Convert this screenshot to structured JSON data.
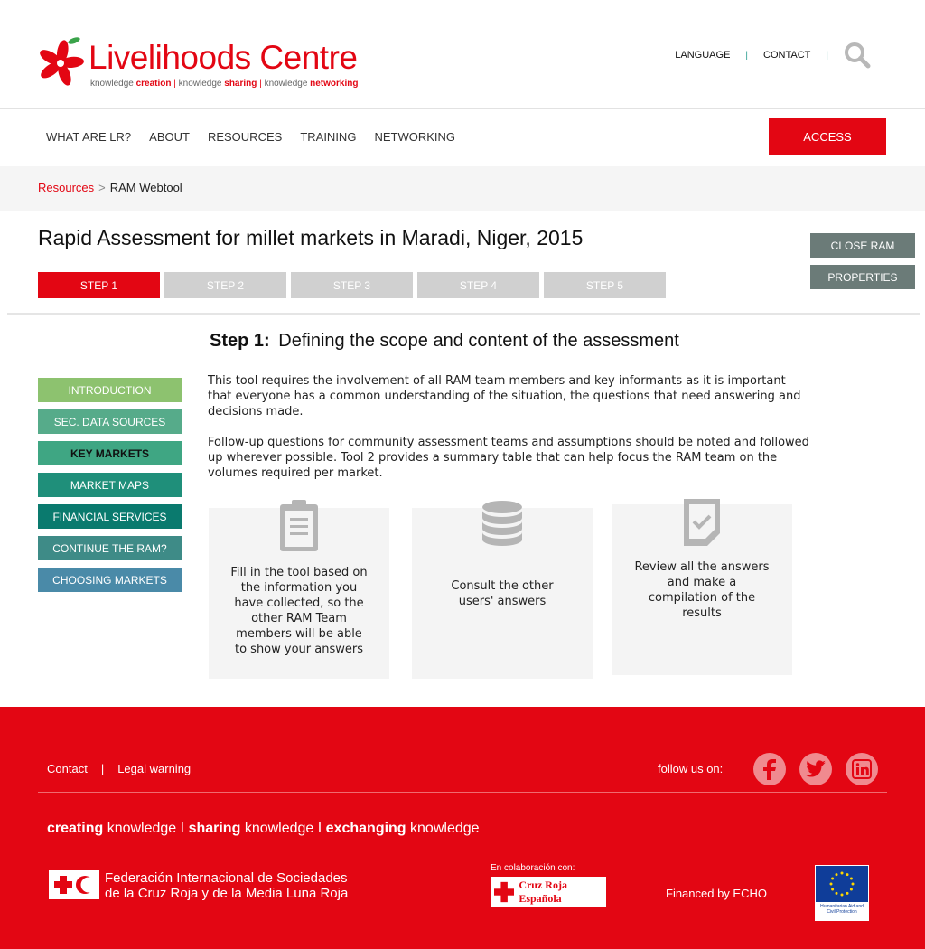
{
  "brand": {
    "title_part1": "Live",
    "title_part2": "lihoods Centre",
    "tagline_prefix1": "knowledge",
    "tagline_word1": "creation",
    "tagline_prefix2": "knowledge",
    "tagline_word2": "sharing",
    "tagline_prefix3": "knowledge",
    "tagline_word3": "networking",
    "tagline_sep": "|",
    "accent_color": "#e30613"
  },
  "top_links": {
    "language": "LANGUAGE",
    "contact": "CONTACT",
    "separator": "|",
    "search_icon": "search-icon"
  },
  "nav": {
    "items": [
      "WHAT ARE LR?",
      "ABOUT",
      "RESOURCES",
      "TRAINING",
      "NETWORKING"
    ],
    "access": "ACCESS"
  },
  "breadcrumb": {
    "link": "Resources",
    "separator": ">",
    "current": "RAM Webtool"
  },
  "page": {
    "title": "Rapid Assessment for millet markets in Maradi, Niger, 2015",
    "steps": [
      "STEP 1",
      "STEP 2",
      "STEP 3",
      "STEP 4",
      "STEP 5"
    ],
    "active_step": 1,
    "close_ram": "CLOSE RAM",
    "properties": "PROPERTIES"
  },
  "step_heading": {
    "label": "Step 1:",
    "text": "Defining the scope and content of the assessment"
  },
  "menu": [
    {
      "label": "INTRODUCTION",
      "color": "#8dc26f"
    },
    {
      "label": "SEC. DATA SOURCES",
      "color": "#56ab8a"
    },
    {
      "label": "KEY MARKETS",
      "color": "#3fa683"
    },
    {
      "label": "MARKET MAPS",
      "color": "#1f8f7a"
    },
    {
      "label": "FINANCIAL SERVICES",
      "color": "#0a7a6e"
    },
    {
      "label": "CONTINUE THE RAM?",
      "color": "#3e8b87"
    },
    {
      "label": "CHOOSING MARKETS",
      "color": "#4a8aa8"
    }
  ],
  "body": {
    "p1": "This tool requires the involvement of all RAM team members and key informants as it is important that everyone has a common understanding of the situation, the questions that need answering and decisions made.",
    "p2": "Follow-up questions for community assessment teams and assumptions should be noted and followed up wherever possible. Tool 2 provides a summary table that can help focus the RAM team on the volumes required per market."
  },
  "cards": [
    {
      "icon": "clipboard-icon",
      "text": "Fill in the tool based on the information you have collected, so the other RAM Team members will be able to show your answers"
    },
    {
      "icon": "database-icon",
      "text": "Consult the other users' answers"
    },
    {
      "icon": "document-check-icon",
      "text": "Review all the answers and make a compilation of the results"
    }
  ],
  "footer": {
    "contact": "Contact",
    "separator": "|",
    "legal": "Legal warning",
    "follow": "follow us on:",
    "social": [
      "facebook-icon",
      "twitter-icon",
      "linkedin-icon"
    ],
    "tagline": {
      "w1": "creating",
      "k1": "knowledge",
      "w2": "sharing",
      "k2": "knowledge",
      "w3": "exchanging",
      "k3": "knowledge",
      "sep": "I"
    },
    "ifrc_line1": "Federación Internacional de Sociedades",
    "ifrc_line2": "de la Cruz Roja y de la Media Luna Roja",
    "collab": "En colaboración con:",
    "cre": "Cruz Roja Española",
    "financed": "Financed by ECHO",
    "eu_text": "Humanitarian Aid and Civil Protection"
  }
}
